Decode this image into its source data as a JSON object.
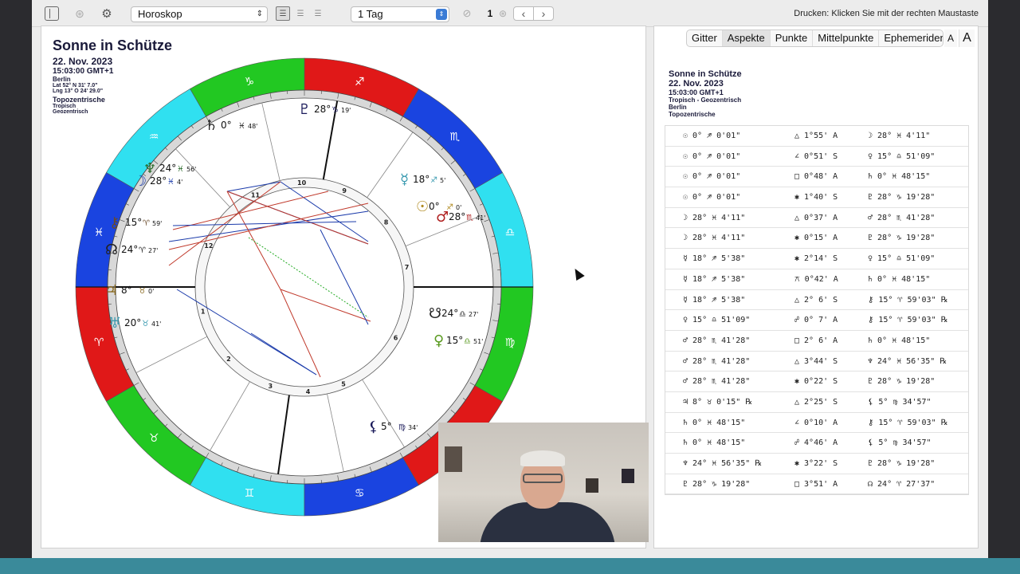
{
  "toolbar": {
    "view_select": "Horoskop",
    "period_select": "1 Tag",
    "counter": "1",
    "print_hint": "Drucken: Klicken Sie mit der rechten Maustaste"
  },
  "chart": {
    "title": "Sonne in Schütze",
    "date": "22. Nov. 2023",
    "time": "15:03:00 GMT+1",
    "place": "Berlin",
    "lat": "Lat 52° N 31' 7.0\"",
    "lng": "Lng 13° O 24' 29.0\"",
    "topo": "Topozentrische",
    "tropisch": "Tropisch",
    "geozentrisch": "Geozentrisch",
    "house_numbers": [
      "1",
      "2",
      "3",
      "4",
      "5",
      "6",
      "7",
      "8",
      "9",
      "10",
      "11",
      "12"
    ],
    "planet_labels": [
      {
        "name": "saturn",
        "glyph": "♄",
        "deg": "0°",
        "sign": "♓",
        "min": "48'",
        "color": "#222"
      },
      {
        "name": "pluto",
        "glyph": "♇",
        "deg": "28°",
        "sign": "♑",
        "min": "19'",
        "color": "#1a1a5a"
      },
      {
        "name": "neptune",
        "glyph": "♆",
        "deg": "24°",
        "sign": "♓",
        "min": "56'",
        "color": "#2a6a2a"
      },
      {
        "name": "moon",
        "glyph": "☽",
        "deg": "28°",
        "sign": "♓",
        "min": "4'",
        "color": "#1a3aaa"
      },
      {
        "name": "mercury",
        "glyph": "☿",
        "deg": "18°",
        "sign": "♐",
        "min": "5'",
        "color": "#3a9ab0"
      },
      {
        "name": "sun",
        "glyph": "☉",
        "deg": "0°",
        "sign": "♐",
        "min": "0'",
        "color": "#b08a20"
      },
      {
        "name": "mars",
        "glyph": "♂",
        "deg": "28°",
        "sign": "♏",
        "min": "41'",
        "color": "#b02020"
      },
      {
        "name": "chiron",
        "glyph": "⚷",
        "deg": "15°",
        "sign": "♈",
        "min": "59'",
        "color": "#6a4a2a"
      },
      {
        "name": "node",
        "glyph": "☊",
        "deg": "24°",
        "sign": "♈",
        "min": "27'",
        "color": "#222"
      },
      {
        "name": "jupiter",
        "glyph": "♃",
        "deg": "8°",
        "sign": "♉",
        "min": "0'",
        "color": "#8a6a20"
      },
      {
        "name": "uranus",
        "glyph": "♅",
        "deg": "20°",
        "sign": "♉",
        "min": "41'",
        "color": "#3a9ab0"
      },
      {
        "name": "south-node",
        "glyph": "☋",
        "deg": "24°",
        "sign": "♎",
        "min": "27'",
        "color": "#222"
      },
      {
        "name": "venus",
        "glyph": "♀",
        "deg": "15°",
        "sign": "♎",
        "min": "51'",
        "color": "#5a9a20"
      },
      {
        "name": "lilith",
        "glyph": "⚸",
        "deg": "5°",
        "sign": "♍",
        "min": "34'",
        "color": "#1a1a5a"
      }
    ]
  },
  "tabs": [
    "Gitter",
    "Aspekte",
    "Punkte",
    "Mittelpunkte",
    "Ephemeriden"
  ],
  "font_small": "A",
  "font_large": "A",
  "right_header": {
    "title": "Sonne in Schütze",
    "date": "22. Nov. 2023",
    "time": "15:03:00 GMT+1",
    "system": "Tropisch - Geozentrisch",
    "place": "Berlin",
    "topo": "Topozentrische"
  },
  "aspects": [
    {
      "a": "☉  0° ♐ 0'01\"",
      "b": "△ 1°55' A",
      "c": "☽ 28° ♓  4'11\""
    },
    {
      "a": "☉  0° ♐ 0'01\"",
      "b": "∠ 0°51' S",
      "c": "♀ 15° ♎ 51'09\""
    },
    {
      "a": "☉  0° ♐ 0'01\"",
      "b": "□ 0°48' A",
      "c": "♄  0° ♓ 48'15\""
    },
    {
      "a": "☉  0° ♐ 0'01\"",
      "b": "✱ 1°40' S",
      "c": "♇ 28° ♑ 19'28\""
    },
    {
      "a": "☽ 28° ♓  4'11\"",
      "b": "△ 0°37' A",
      "c": "♂ 28° ♏ 41'28\""
    },
    {
      "a": "☽ 28° ♓  4'11\"",
      "b": "✱ 0°15' A",
      "c": "♇ 28° ♑ 19'28\""
    },
    {
      "a": "☿ 18° ♐  5'38\"",
      "b": "✱ 2°14' S",
      "c": "♀ 15° ♎ 51'09\""
    },
    {
      "a": "☿ 18° ♐  5'38\"",
      "b": "⚻ 0°42' A",
      "c": "♄  0° ♓ 48'15\""
    },
    {
      "a": "☿ 18° ♐  5'38\"",
      "b": "△ 2° 6' S",
      "c": "⚷ 15° ♈ 59'03\" ℞"
    },
    {
      "a": "♀ 15° ♎ 51'09\"",
      "b": "☍ 0° 7' A",
      "c": "⚷ 15° ♈ 59'03\" ℞"
    },
    {
      "a": "♂ 28° ♏ 41'28\"",
      "b": "□ 2° 6' A",
      "c": "♄  0° ♓ 48'15\""
    },
    {
      "a": "♂ 28° ♏ 41'28\"",
      "b": "△ 3°44' S",
      "c": "♆ 24° ♓ 56'35\" ℞"
    },
    {
      "a": "♂ 28° ♏ 41'28\"",
      "b": "✱ 0°22' S",
      "c": "♇ 28° ♑ 19'28\""
    },
    {
      "a": "♃  8° ♉  0'15\" ℞",
      "b": "△ 2°25' S",
      "c": "⚸  5° ♍ 34'57\""
    },
    {
      "a": "♄  0° ♓ 48'15\"",
      "b": "∠ 0°10' A",
      "c": "⚷ 15° ♈ 59'03\" ℞"
    },
    {
      "a": "♄  0° ♓ 48'15\"",
      "b": "☍ 4°46' A",
      "c": "⚸  5° ♍ 34'57\""
    },
    {
      "a": "♆ 24° ♓ 56'35\" ℞",
      "b": "✱ 3°22' S",
      "c": "♇ 28° ♑ 19'28\""
    },
    {
      "a": "♇ 28° ♑ 19'28\"",
      "b": "□ 3°51' A",
      "c": "☊ 24° ♈ 27'37\""
    }
  ],
  "colors": {
    "fire": "#e01818",
    "earth": "#22c822",
    "air": "#30e0f0",
    "water": "#1a44e0"
  },
  "zodiac_signs": [
    "♈",
    "♉",
    "♊",
    "♋",
    "♌",
    "♍",
    "♎",
    "♏",
    "♐",
    "♑",
    "♒",
    "♓"
  ]
}
